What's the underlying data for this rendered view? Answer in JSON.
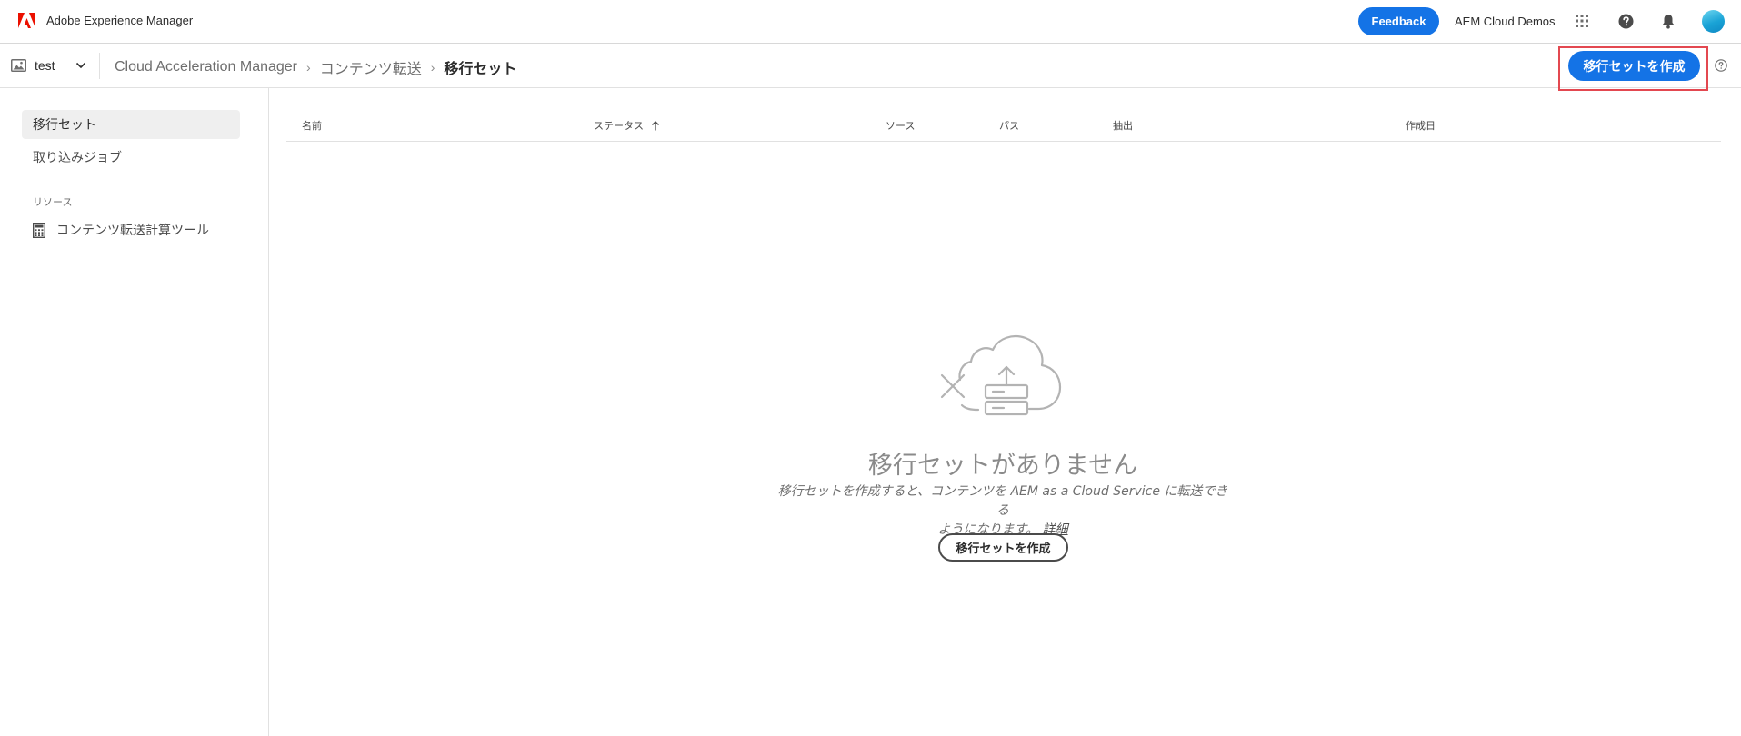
{
  "shell": {
    "app_title": "Adobe Experience Manager",
    "feedback_label": "Feedback",
    "org_name": "AEM Cloud Demos",
    "brand_color": "#eb1000",
    "accent_color": "#1473e6"
  },
  "env_picker": {
    "value": "test",
    "icon": "image-icon"
  },
  "breadcrumb": {
    "items": [
      "Cloud Acceleration Manager",
      "コンテンツ転送"
    ],
    "current": "移行セット",
    "separator": "›"
  },
  "actions": {
    "create_label": "移行セットを作成"
  },
  "nav": {
    "items": [
      {
        "label": "移行セット",
        "selected": true
      },
      {
        "label": "取り込みジョブ",
        "selected": false
      }
    ],
    "section_label": "リソース",
    "tool_label": "コンテンツ転送計算ツール",
    "tool_icon": "calculator-icon"
  },
  "table": {
    "columns": [
      {
        "label": "名前"
      },
      {
        "label": "ステータス",
        "sorted": "ascending"
      },
      {
        "label": "ソース"
      },
      {
        "label": "パス"
      },
      {
        "label": "抽出"
      },
      {
        "label": "作成日"
      }
    ]
  },
  "empty_state": {
    "title": "移行セットがありません",
    "description": "移行セットを作成すると、コンテンツを AEM as a Cloud Service に転送できる",
    "description_line2": "ようになります。",
    "link_label": "詳細",
    "button_label": "移行セットを作成",
    "icon": "cloud-upload-error-icon"
  }
}
